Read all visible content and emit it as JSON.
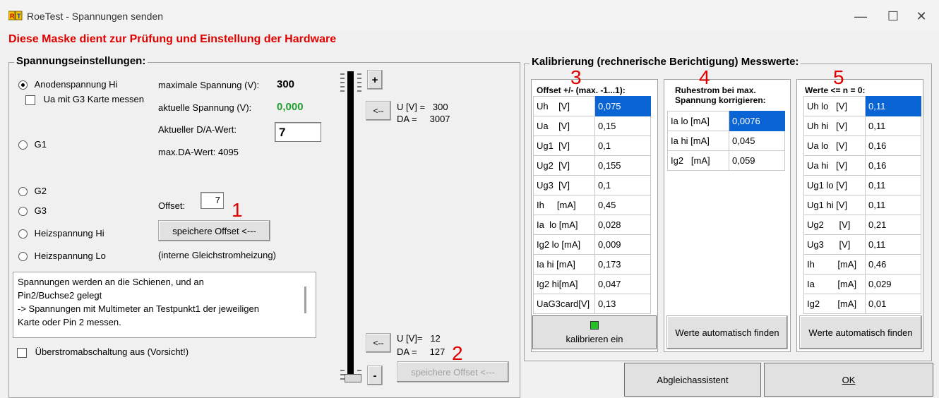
{
  "window": {
    "title": "RoeTest - Spannungen senden",
    "minimize": "—",
    "maximize": "☐",
    "close": "✕"
  },
  "subtitle": "Diese Maske dient zur Prüfung und Einstellung der Hardware",
  "left": {
    "legend": "Spannungseinstellungen:",
    "radios": [
      {
        "label": "Anodenspannung Hi",
        "checked": true
      },
      {
        "label": "G1",
        "checked": false
      },
      {
        "label": "G2",
        "checked": false
      },
      {
        "label": "G3",
        "checked": false
      },
      {
        "label": "Heizspannung Hi",
        "checked": false
      },
      {
        "label": "Heizspannung Lo",
        "checked": false
      }
    ],
    "ua_g3_label": "Ua mit G3 Karte messen",
    "max_voltage_label": "maximale Spannung (V):",
    "max_voltage_value": "300",
    "current_voltage_label": "aktuelle Spannung (V):",
    "current_voltage_value": "0,000",
    "da_value_label": "Aktueller D/A-Wert:",
    "da_value": "7",
    "max_da_label": "max.DA-Wert: 4095",
    "offset_label": "Offset:",
    "offset_value": "7",
    "marker_1": "1",
    "save_offset_label": "speichere Offset <---",
    "internal_heating_note": "(interne Gleichstromheizung)",
    "memo_lines": [
      "Spannungen werden an die Schienen, und an",
      "Pin2/Buchse2 gelegt",
      "-> Spannungen mit Multimeter an Testpunkt1 der jeweiligen",
      "Karte oder Pin 2 messen."
    ],
    "overcurrent_label": "Überstromabschaltung aus (Vorsicht!)"
  },
  "slider": {
    "plus_label": "+",
    "minus_label": "-",
    "top_arrow": "<--",
    "bottom_arrow": "<--",
    "top_u": "U [V] =   300",
    "top_da": "DA =     3007",
    "bottom_u": "U [V]=   12",
    "bottom_da": "DA =     127",
    "marker_2": "2",
    "save_offset_label": "speichere Offset <---",
    "level_fraction": 0.0
  },
  "calibration": {
    "legend": "Kalibrierung (rechnerische Berichtigung) Messwerte:",
    "offset": {
      "marker": "3",
      "header": "Offset +/-  (max. -1...1):",
      "rows": [
        [
          "Uh    [V]",
          "0,075"
        ],
        [
          "Ua    [V]",
          "0,15"
        ],
        [
          "Ug1  [V]",
          "0,1"
        ],
        [
          "Ug2  [V]",
          "0,155"
        ],
        [
          "Ug3  [V]",
          "0,1"
        ],
        [
          "Ih     [mA]",
          "0,45"
        ],
        [
          "Ia  lo [mA]",
          "0,028"
        ],
        [
          "Ig2 lo [mA]",
          "0,009"
        ],
        [
          "Ia hi [mA]",
          "0,173"
        ],
        [
          "Ig2 hi[mA]",
          "0,047"
        ],
        [
          "UaG3card[V]",
          "0,13"
        ]
      ],
      "button_label": "kalibrieren ein",
      "led_color": "#22c322"
    },
    "ruhestrom": {
      "marker": "4",
      "header_line1": "Ruhestrom bei max.",
      "header_line2": "Spannung korrigieren:",
      "rows": [
        [
          "Ia lo [mA]",
          "0,0076"
        ],
        [
          "Ia hi [mA]",
          "0,045"
        ],
        [
          "Ig2   [mA]",
          "0,059"
        ]
      ],
      "button_label": "Werte automatisch finden"
    },
    "werte": {
      "marker": "5",
      "header": "Werte <= n = 0:",
      "rows": [
        [
          "Uh lo   [V]",
          "0,11"
        ],
        [
          "Uh hi   [V]",
          "0,11"
        ],
        [
          "Ua lo   [V]",
          "0,16"
        ],
        [
          "Ua hi   [V]",
          "0,16"
        ],
        [
          "Ug1 lo [V]",
          "0,11"
        ],
        [
          "Ug1 hi [V]",
          "0,11"
        ],
        [
          "Ug2      [V]",
          "0,21"
        ],
        [
          "Ug3      [V]",
          "0,11"
        ],
        [
          "Ih         [mA]",
          "0,46"
        ],
        [
          "Ia         [mA]",
          "0,029"
        ],
        [
          "Ig2       [mA]",
          "0,01"
        ]
      ],
      "button_label": "Werte automatisch finden"
    }
  },
  "footer": {
    "assistant_label": "Abgleichassistent",
    "ok_label": "OK"
  }
}
